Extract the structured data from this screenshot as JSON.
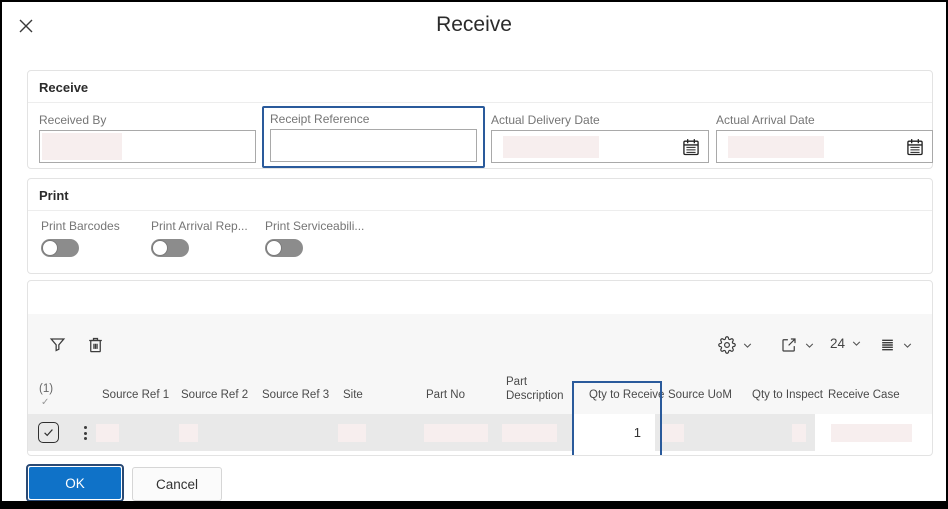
{
  "dialog": {
    "title": "Receive"
  },
  "receive_section": {
    "title": "Receive",
    "fields": [
      {
        "label": "Received By",
        "value": "",
        "redacted": true
      },
      {
        "label": "Receipt Reference",
        "value": "",
        "focused": true
      },
      {
        "label": "Actual Delivery Date",
        "value": "",
        "redacted": true,
        "icon": "calendar-icon"
      },
      {
        "label": "Actual Arrival Date",
        "value": "",
        "redacted": true,
        "icon": "calendar-icon"
      }
    ]
  },
  "print_section": {
    "title": "Print",
    "toggles": [
      {
        "label": "Print Barcodes",
        "state": "off"
      },
      {
        "label": "Print Arrival Rep...",
        "state": "off"
      },
      {
        "label": "Print Serviceabili...",
        "state": "off"
      }
    ]
  },
  "table": {
    "toolbar": {
      "left_icons": [
        "filter-icon",
        "delete-icon"
      ],
      "right_icons": [
        "settings-icon",
        "export-icon",
        "density-icon"
      ],
      "page_size": "24"
    },
    "selection_count": "(1)",
    "select_all_check": "✓",
    "columns": [
      "Source Ref 1",
      "Source Ref 2",
      "Source Ref 3",
      "Site",
      "Part No",
      "Part Description",
      "Qty to Receive",
      "Source UoM",
      "Qty to Inspect",
      "Receive Case"
    ],
    "row": {
      "selected": true,
      "qty_to_receive": "1",
      "focused_column": "Qty to Receive"
    }
  },
  "footer": {
    "ok_label": "OK",
    "cancel_label": "Cancel"
  },
  "colors": {
    "focus_blue": "#2a5a9b",
    "primary_button_blue": "#0f72c8",
    "redaction_pink": "#f7eeee",
    "row_gray": "#e9e9e9",
    "panel_gray": "#f7f7f7"
  }
}
